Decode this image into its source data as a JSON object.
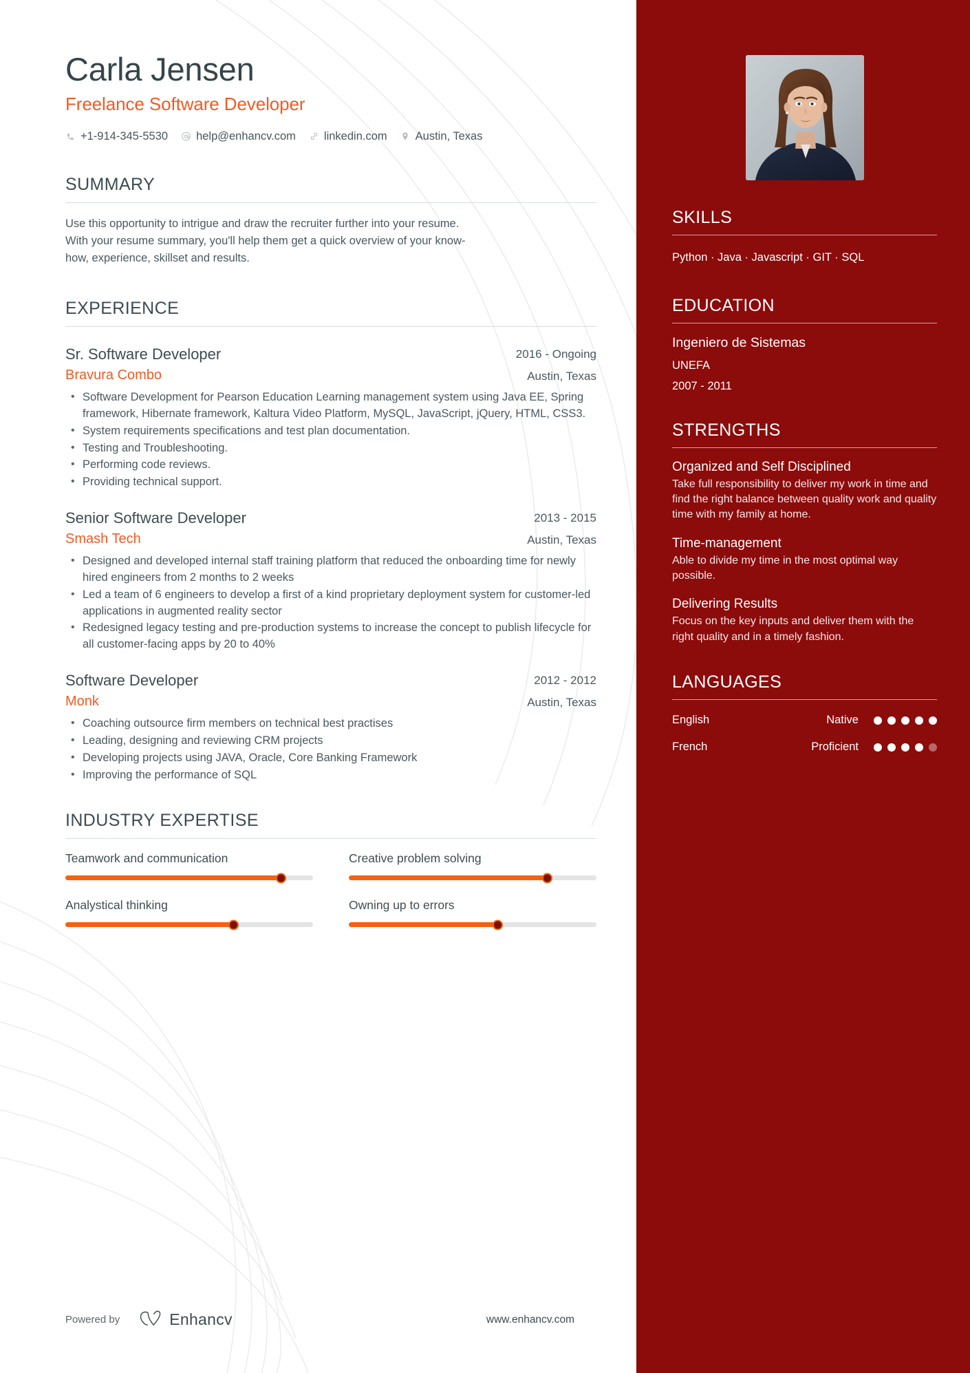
{
  "theme": {
    "accent_orange": "#f15a22",
    "sidebar_red": "#8c0b0b",
    "heading_slate": "#3d4b51",
    "body_text": "#4a585e",
    "slider_fill": "#f4620f",
    "slider_thumb": "#7a1105",
    "slider_track": "#e4e4e4"
  },
  "header": {
    "name": "Carla Jensen",
    "job_title": "Freelance Software Developer",
    "contacts": [
      {
        "icon": "phone-icon",
        "value": "+1-914-345-5530"
      },
      {
        "icon": "email-icon",
        "value": "help@enhancv.com"
      },
      {
        "icon": "link-icon",
        "value": "linkedin.com"
      },
      {
        "icon": "location-pin-icon",
        "value": "Austin, Texas"
      }
    ]
  },
  "summary": {
    "title": "SUMMARY",
    "text": "Use this opportunity to intrigue and draw the recruiter further into your resume. With your resume summary, you'll help them get a quick overview of your know-how, experience, skillset and results."
  },
  "experience": {
    "title": "EXPERIENCE",
    "jobs": [
      {
        "role": "Sr. Software Developer",
        "company": "Bravura Combo",
        "dates": "2016 - Ongoing",
        "location": "Austin, Texas",
        "bullets": [
          "Software Development for Pearson Education Learning management system using Java EE, Spring framework, Hibernate framework, Kaltura Video Platform, MySQL, JavaScript, jQuery, HTML, CSS3.",
          "System requirements specifications and test plan documentation.",
          "Testing and Troubleshooting.",
          "Performing code reviews.",
          "Providing technical support."
        ]
      },
      {
        "role": "Senior Software Developer",
        "company": "Smash Tech",
        "dates": "2013 - 2015",
        "location": "Austin, Texas",
        "bullets": [
          "Designed and developed internal staff training platform that reduced the onboarding time for newly hired engineers from 2 months to 2 weeks",
          "Led a team of 6 engineers to develop a first of a kind proprietary deployment system for customer-led applications in augmented reality sector",
          "Redesigned legacy testing and pre-production systems to increase the concept to publish lifecycle for all customer-facing apps by 20 to 40%"
        ]
      },
      {
        "role": "Software Developer",
        "company": "Monk",
        "dates": "2012 - 2012",
        "location": "Austin, Texas",
        "bullets": [
          "Coaching outsource firm members on technical best practises",
          "Leading, designing and reviewing CRM projects",
          "Developing projects using JAVA, Oracle, Core Banking Framework",
          "Improving the performance of SQL"
        ]
      }
    ]
  },
  "industry_expertise": {
    "title": "INDUSTRY EXPERTISE",
    "items": [
      {
        "label": "Teamwork and communication",
        "percent": 87
      },
      {
        "label": "Creative problem solving",
        "percent": 80
      },
      {
        "label": "Analystical thinking",
        "percent": 68
      },
      {
        "label": "Owning up to errors",
        "percent": 60
      }
    ]
  },
  "footer": {
    "powered_by": "Powered by",
    "brand": "Enhancv",
    "url": "www.enhancv.com"
  },
  "sidebar": {
    "photo_alt": "avatar",
    "skills": {
      "title": "SKILLS",
      "list": [
        "Python",
        "Java",
        "Javascript",
        "GIT",
        "SQL"
      ],
      "separator": " · ",
      "text": "Python · Java · Javascript · GIT · SQL"
    },
    "education": {
      "title": "EDUCATION",
      "degree": "Ingeniero de Sistemas",
      "school": "UNEFA",
      "years": "2007 - 2011"
    },
    "strengths": {
      "title": "STRENGTHS",
      "items": [
        {
          "name": "Organized and Self Disciplined",
          "description": "Take full responsibility to deliver my work in time and find the right balance between quality work and quality time with my family at home."
        },
        {
          "name": "Time-management",
          "description": "Able to divide my time in the most optimal way possible."
        },
        {
          "name": "Delivering Results",
          "description": "Focus on the key inputs and deliver them with the right quality and in a timely fashion."
        }
      ]
    },
    "languages": {
      "title": "LANGUAGES",
      "items": [
        {
          "name": "English",
          "level": "Native",
          "rating": 5,
          "max": 5
        },
        {
          "name": "French",
          "level": "Proficient",
          "rating": 4,
          "max": 5
        }
      ]
    }
  }
}
